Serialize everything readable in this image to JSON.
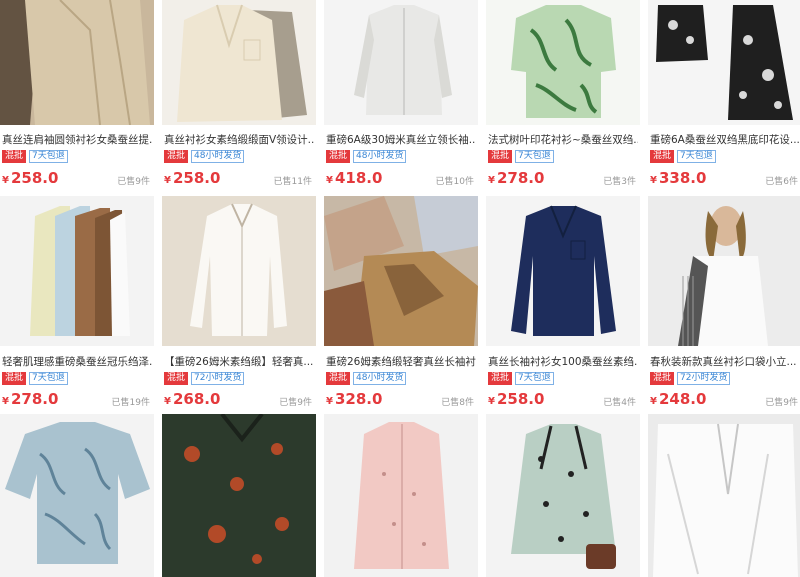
{
  "products": [
    {
      "title": "真丝连肩袖圆领衬衫女桑蚕丝提...",
      "tag_a": "混批",
      "tag_b": "7天包退",
      "currency": "¥",
      "price": "258.0",
      "sold": "已售9件",
      "bg": "#c9b79c",
      "fg": "#d8c8aa",
      "dark": "#4a3a2c"
    },
    {
      "title": "真丝衬衫女素绉缎缎面V领设计...",
      "tag_a": "混批",
      "tag_b": "48小时发货",
      "currency": "¥",
      "price": "258.0",
      "sold": "已售11件",
      "bg": "#f2efe9",
      "fg": "#efe6d2",
      "dark": "#a79e8e"
    },
    {
      "title": "重磅6A级30姆米真丝立领长袖...",
      "tag_a": "混批",
      "tag_b": "48小时发货",
      "currency": "¥",
      "price": "418.0",
      "sold": "已售10件",
      "bg": "#f4f4f4",
      "fg": "#e8e8e6",
      "dark": "#b9b9b5"
    },
    {
      "title": "法式树叶印花衬衫~桑蚕丝双绉...",
      "tag_a": "混批",
      "tag_b": "7天包退",
      "currency": "¥",
      "price": "278.0",
      "sold": "已售3件",
      "bg": "#f5f7f3",
      "fg": "#b9d8b2",
      "dark": "#3c7a3f"
    },
    {
      "title": "重磅6A桑蚕丝双绉黑底印花设...",
      "tag_a": "混批",
      "tag_b": "7天包退",
      "currency": "¥",
      "price": "338.0",
      "sold": "已售6件",
      "bg": "#f5f5f5",
      "fg": "#d9d9d9",
      "dark": "#1f1f1f"
    },
    {
      "title": "轻奢肌理感重磅桑蚕丝冠乐绉泽...",
      "tag_a": "混批",
      "tag_b": "7天包退",
      "currency": "¥",
      "price": "278.0",
      "sold": "已售19件",
      "bg": "#f3f3f3",
      "fg": "#e9e7bf",
      "dark": "#9a6b46"
    },
    {
      "title": "【重磅26姆米素绉缎】轻奢真...",
      "tag_a": "混批",
      "tag_b": "72小时发货",
      "currency": "¥",
      "price": "268.0",
      "sold": "已售9件",
      "bg": "#e5ddd0",
      "fg": "#faf8f4",
      "dark": "#bfb4a3"
    },
    {
      "title": "重磅26姆素绉缎轻奢真丝长袖衬...",
      "tag_a": "混批",
      "tag_b": "48小时发货",
      "currency": "¥",
      "price": "328.0",
      "sold": "已售8件",
      "bg": "#c7b8a6",
      "fg": "#b48a55",
      "dark": "#6d4a2a"
    },
    {
      "title": "真丝长袖衬衫女100桑蚕丝素绉...",
      "tag_a": "混批",
      "tag_b": "7天包退",
      "currency": "¥",
      "price": "258.0",
      "sold": "已售4件",
      "bg": "#f4f4f4",
      "fg": "#1e2d5c",
      "dark": "#13203f"
    },
    {
      "title": "春秋装新款真丝衬衫口袋小立...",
      "tag_a": "混批",
      "tag_b": "72小时发货",
      "currency": "¥",
      "price": "248.0",
      "sold": "已售9件",
      "bg": "#ececec",
      "fg": "#fafafa",
      "dark": "#555555"
    },
    {
      "bg": "#f3f3f3",
      "fg": "#a9c2cf",
      "dark": "#5f8399"
    },
    {
      "bg": "#2c3a2c",
      "fg": "#b24a28",
      "dark": "#1b221b"
    },
    {
      "bg": "#f2f2f2",
      "fg": "#f2c9c4",
      "dark": "#c48f8b"
    },
    {
      "bg": "#f3f3f3",
      "fg": "#b9cfc4",
      "dark": "#222222"
    },
    {
      "bg": "#ebebeb",
      "fg": "#fbfbfb",
      "dark": "#c6c6c6"
    }
  ]
}
